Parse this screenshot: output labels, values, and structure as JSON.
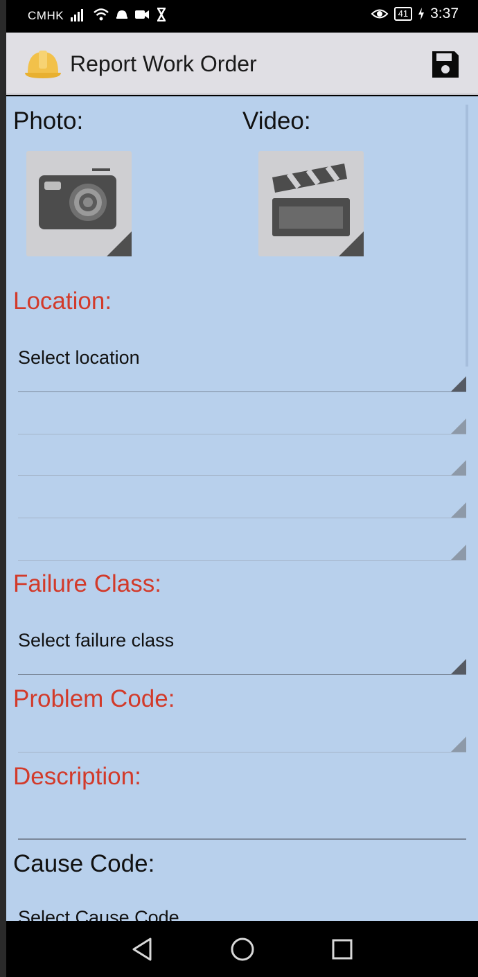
{
  "status_bar": {
    "carrier": "CMHK",
    "battery": "41",
    "time": "3:37"
  },
  "app_bar": {
    "title": "Report Work Order"
  },
  "media": {
    "photo_label": "Photo:",
    "video_label": "Video:"
  },
  "location": {
    "label": "Location:",
    "placeholder": "Select location"
  },
  "failure_class": {
    "label": "Failure Class:",
    "placeholder": "Select failure class"
  },
  "problem_code": {
    "label": "Problem Code:"
  },
  "description": {
    "label": "Description:"
  },
  "cause_code": {
    "label": "Cause Code:",
    "placeholder_partial": "Select Cause Code"
  },
  "colors": {
    "content_bg": "#b8d0ec",
    "app_bar_bg": "#e0dfe4",
    "required_label": "#d23a2a"
  },
  "icons": {
    "app": "hard-hat-icon",
    "save": "floppy-disk-icon",
    "photo": "camera-icon",
    "video": "clapperboard-icon"
  }
}
